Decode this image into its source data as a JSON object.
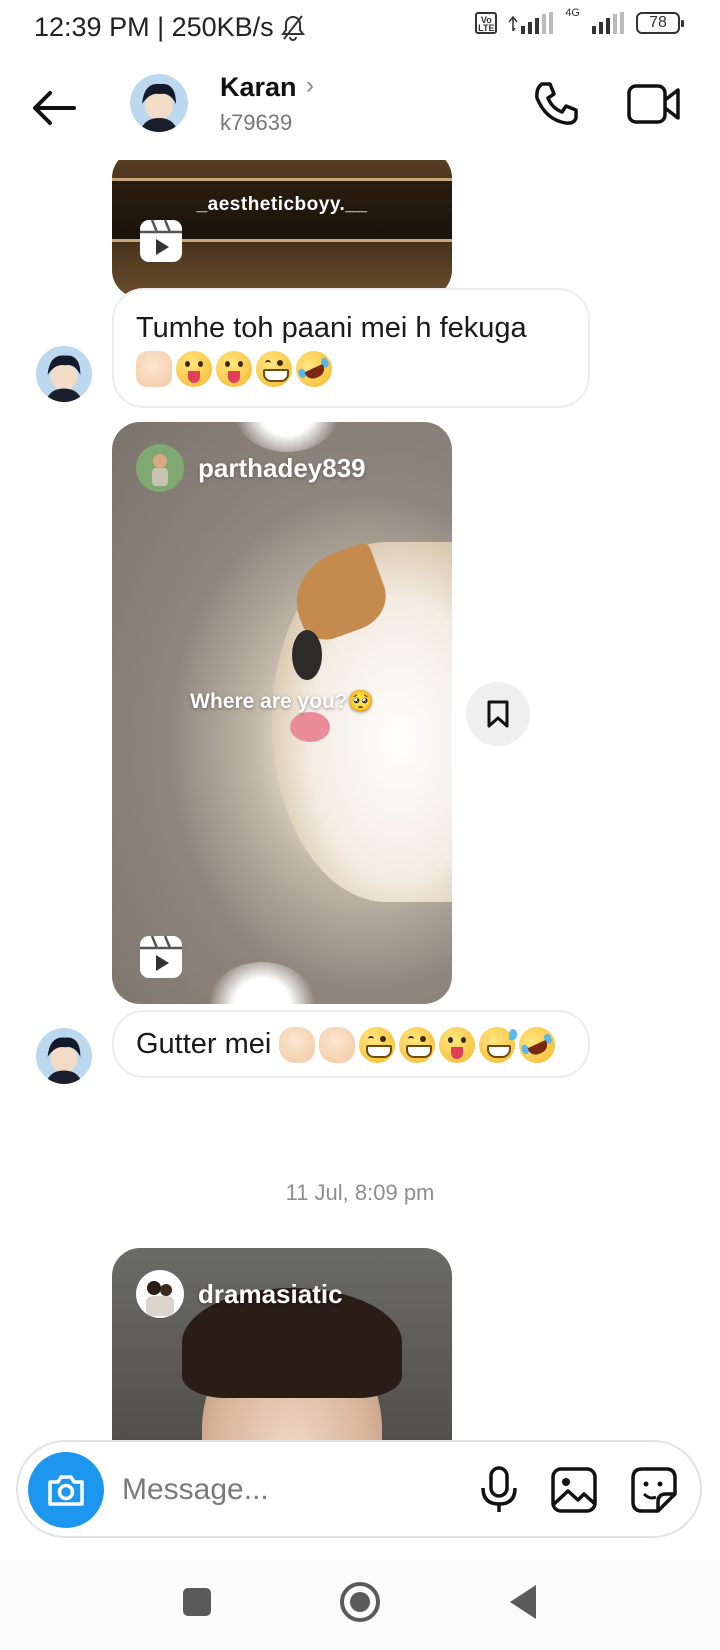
{
  "status_bar": {
    "time_speed": "12:39 PM | 250KB/s",
    "network_type": "4G",
    "volte": "Vo LTE",
    "battery": "78"
  },
  "header": {
    "name": "Karan",
    "handle": "k79639"
  },
  "chat": {
    "top_reel_caption": "_aestheticboyy.__",
    "message1": {
      "text": "Tumhe toh paani mei h fekuga",
      "emojis": [
        "thumbs-up-light",
        "tongue-face",
        "tongue-face",
        "grinning-face",
        "rolling-laughing-face"
      ]
    },
    "reel2": {
      "username": "parthadey839",
      "caption": "Where are you?🥺"
    },
    "message2": {
      "text": "Gutter mei",
      "emojis": [
        "raised-hand-light",
        "raised-hand-light",
        "grinning-face",
        "grinning-face",
        "tongue-face",
        "grinning-sweat-face",
        "rolling-laughing-face"
      ]
    },
    "timestamp": "11 Jul, 8:09 pm",
    "reel3": {
      "username": "dramasiatic"
    }
  },
  "composer": {
    "placeholder": "Message..."
  },
  "colors": {
    "accent_blue": "#1d96f0",
    "bubble_border": "#ececec",
    "muted_text": "#8e8e8e"
  }
}
